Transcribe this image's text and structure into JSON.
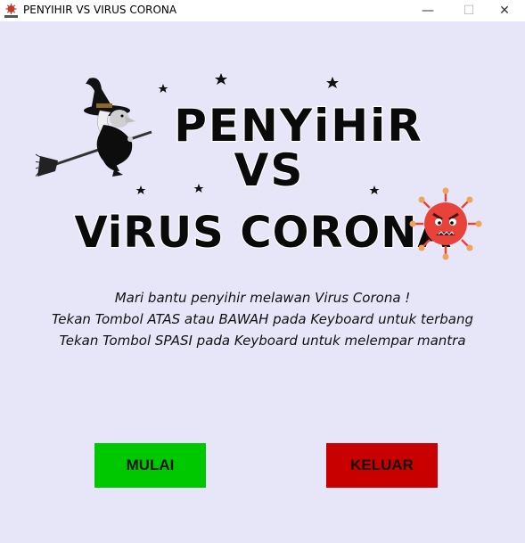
{
  "window": {
    "title": "PENYIHIR VS VIRUS CORONA",
    "minimize_glyph": "—",
    "maximize_glyph": "☐",
    "close_glyph": "✕"
  },
  "logo": {
    "line1": "PENYiHiR",
    "line2": "VS",
    "line3": "ViRUS CORONA"
  },
  "instructions": {
    "line1": "Mari bantu penyihir melawan Virus Corona !",
    "line2": "Tekan Tombol ATAS atau BAWAH pada Keyboard untuk terbang",
    "line3": "Tekan Tombol SPASI pada Keyboard untuk melempar mantra"
  },
  "buttons": {
    "start_label": "MULAI",
    "exit_label": "KELUAR"
  },
  "colors": {
    "background": "#e6e6f8",
    "start_button": "#00c800",
    "exit_button": "#c80000",
    "virus": "#e8433a"
  },
  "icons": [
    "app-virus-icon",
    "witch-icon",
    "virus-icon",
    "star-icon"
  ]
}
